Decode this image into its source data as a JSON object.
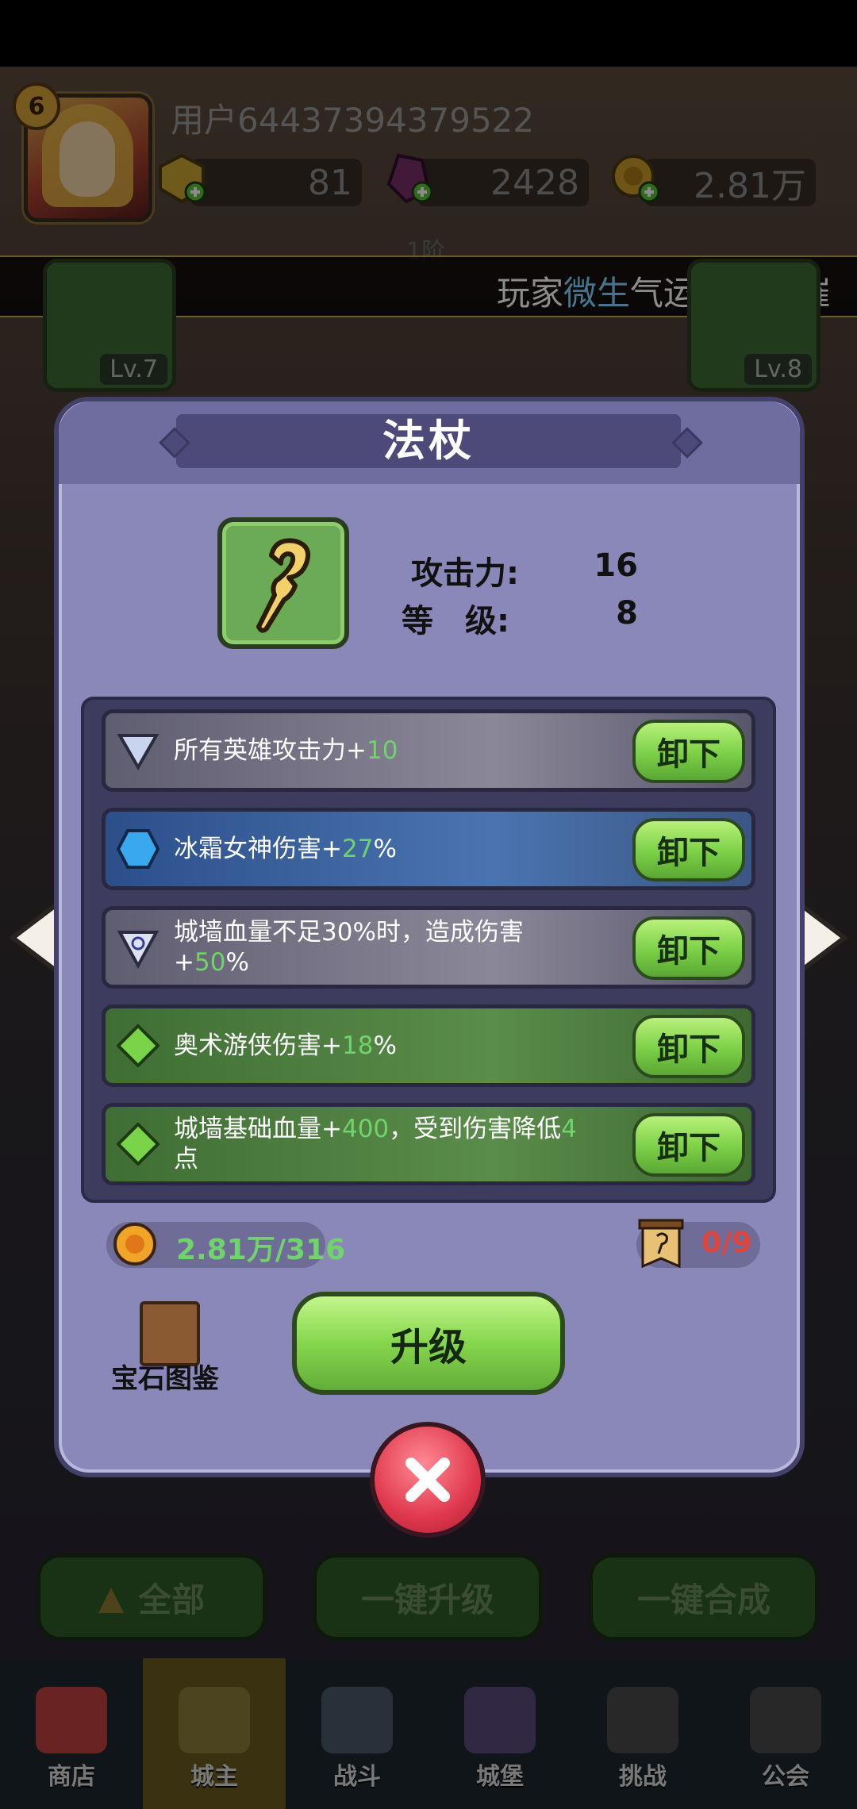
{
  "header": {
    "level": "6",
    "username": "用户6443739437952​2",
    "resources": [
      {
        "icon": "gold-gem-icon",
        "value": "81"
      },
      {
        "icon": "purple-crystal-icon",
        "value": "2428"
      },
      {
        "icon": "gold-coin-icon",
        "value": "2.81万"
      }
    ]
  },
  "tier_text": "1阶",
  "marquee": {
    "prefix": "玩家",
    "player": "微生",
    "suffix": "气运惊人，璀"
  },
  "equip_slots": {
    "left_lv": "Lv.7",
    "right_lv": "Lv.8"
  },
  "modal": {
    "title": "法杖",
    "item_icon": "staff-icon",
    "stats": [
      {
        "label": "攻击力:",
        "value": "16"
      },
      {
        "label": "等　级:",
        "value": "8"
      }
    ],
    "gems": [
      {
        "icon": "silver-triangle-gem-icon",
        "text": "所有英雄攻击力+",
        "num": "10",
        "suffix": "",
        "style": "gray",
        "button": "卸下"
      },
      {
        "icon": "blue-hexagon-gem-icon",
        "text": "冰霜女神伤害+",
        "num": "27",
        "suffix": "%",
        "style": "blue",
        "button": "卸下"
      },
      {
        "icon": "swirl-shield-gem-icon",
        "text": "城墙血量不足30%时，造成伤害+",
        "num": "50",
        "suffix": "%",
        "style": "gray",
        "button": "卸下"
      },
      {
        "icon": "green-diamond-gem-icon",
        "text": "奥术游侠伤害+",
        "num": "18",
        "suffix": "%",
        "style": "green",
        "button": "卸下"
      },
      {
        "icon": "green-diamond-gem-icon",
        "text": "城墙基础血量+",
        "num": "400",
        "suffix": "，受到伤害降低",
        "num2": "4",
        "suffix2": "点",
        "style": "green",
        "button": "卸下"
      }
    ],
    "cost": "2.81万/316",
    "scroll_count": "0/9",
    "gem_book_label": "宝石图鉴",
    "upgrade_label": "升级"
  },
  "actions": {
    "all": "全部",
    "upgrade_all": "一键升级",
    "merge_all": "一键合成"
  },
  "nav": [
    "商店",
    "城主",
    "战斗",
    "城堡",
    "挑战",
    "公会"
  ],
  "colors": {
    "accent_green": "#7bd046",
    "highlight_num": "#6fd46a",
    "danger_red": "#e0443a",
    "modal_bg": "#8a88b8"
  }
}
